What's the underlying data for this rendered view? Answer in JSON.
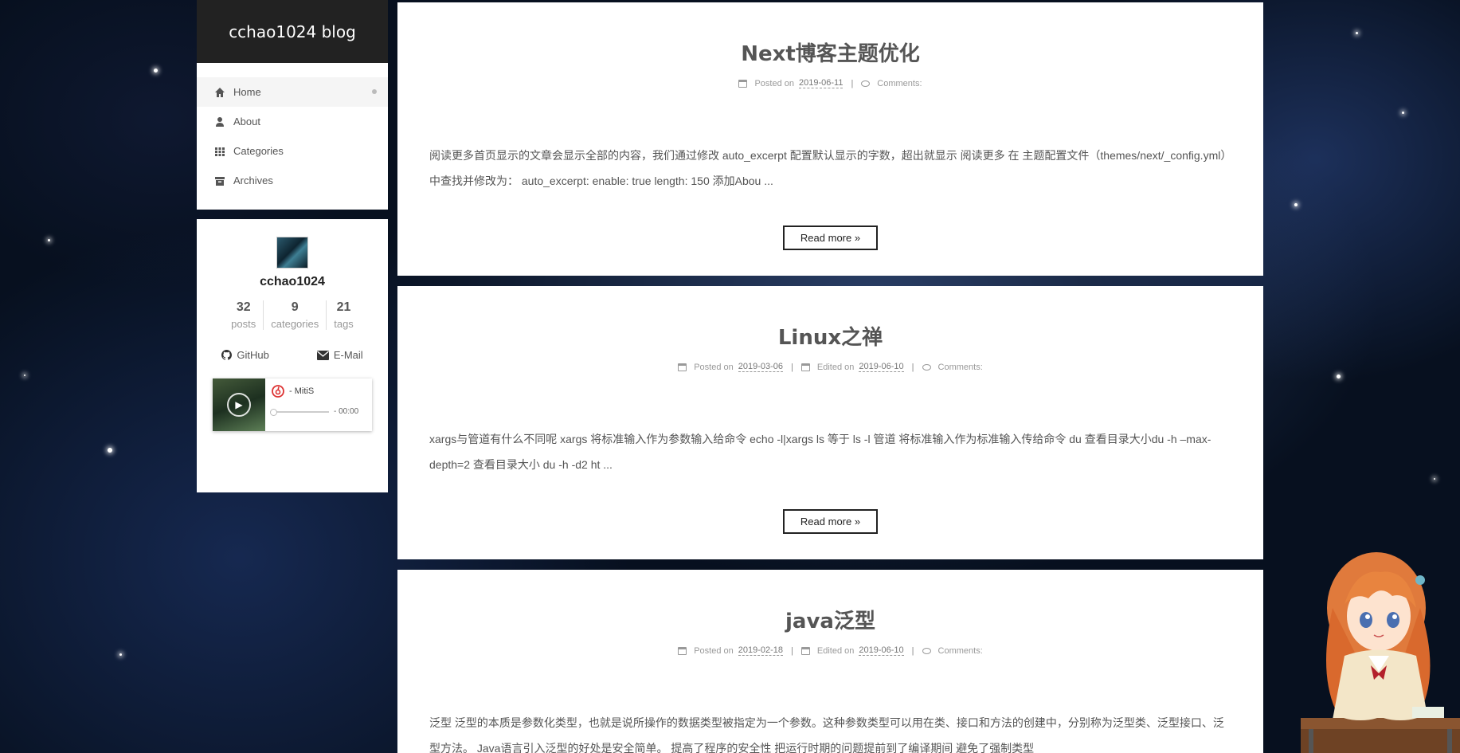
{
  "site": {
    "title": "cchao1024 blog"
  },
  "menu": {
    "items": [
      {
        "label": "Home",
        "icon": "home-icon",
        "active": true
      },
      {
        "label": "About",
        "icon": "user-icon",
        "active": false
      },
      {
        "label": "Categories",
        "icon": "grid-icon",
        "active": false
      },
      {
        "label": "Archives",
        "icon": "archive-icon",
        "active": false
      }
    ]
  },
  "profile": {
    "name": "cchao1024",
    "stats": [
      {
        "count": "32",
        "label": "posts"
      },
      {
        "count": "9",
        "label": "categories"
      },
      {
        "count": "21",
        "label": "tags"
      }
    ],
    "links": [
      {
        "label": "GitHub",
        "icon": "github-icon"
      },
      {
        "label": "E-Mail",
        "icon": "envelope-icon"
      }
    ]
  },
  "player": {
    "title": "- MitiS",
    "time": "- 00:00"
  },
  "posts": [
    {
      "title": "Next博客主题优化",
      "posted_label": "Posted on",
      "posted_date": "2019-06-11",
      "edited_label": "",
      "edited_date": "",
      "comments_label": "Comments:",
      "excerpt": "阅读更多首页显示的文章会显示全部的内容，我们通过修改 auto_excerpt 配置默认显示的字数，超出就显示 阅读更多 在 主题配置文件（themes/next/_config.yml）中查找并修改为： auto_excerpt: enable: true length: 150 添加Abou ...",
      "read_more": "Read more »"
    },
    {
      "title": "Linux之禅",
      "posted_label": "Posted on",
      "posted_date": "2019-03-06",
      "edited_label": "Edited on",
      "edited_date": "2019-06-10",
      "comments_label": "Comments:",
      "excerpt": "xargs与管道有什么不同呢 xargs 将标准输入作为参数输入给命令 echo -l|xargs ls 等于 ls -l 管道 将标准输入作为标准输入传给命令 du 查看目录大小du -h –max-depth=2 查看目录大小 du -h -d2 ht ...",
      "read_more": "Read more »"
    },
    {
      "title": "java泛型",
      "posted_label": "Posted on",
      "posted_date": "2019-02-18",
      "edited_label": "Edited on",
      "edited_date": "2019-06-10",
      "comments_label": "Comments:",
      "excerpt": "泛型 泛型的本质是参数化类型，也就是说所操作的数据类型被指定为一个参数。这种参数类型可以用在类、接口和方法的创建中，分别称为泛型类、泛型接口、泛型方法。 Java语言引入泛型的好处是安全简单。 提高了程序的安全性 把运行时期的问题提前到了编译期间 避免了强制类型",
      "read_more": "Read more »"
    }
  ]
}
